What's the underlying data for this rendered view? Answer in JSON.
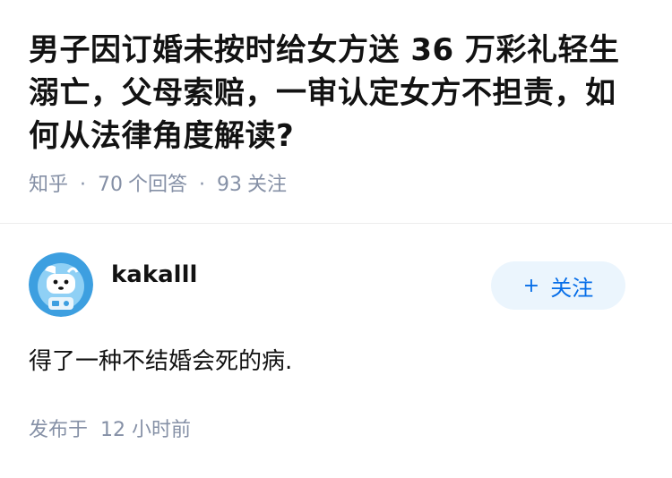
{
  "question": {
    "title": "男子因订婚未按时给女方送 36 万彩礼轻生溺亡，父母索赔，一审认定女方不担责，如何从法律角度解读?",
    "source": "知乎",
    "separator": "·",
    "answers_count": "70",
    "answers_label": "个回答",
    "followers_count": "93",
    "followers_label": "关注"
  },
  "answer": {
    "author_name": "kakalll",
    "follow_plus": "+",
    "follow_label": "关注",
    "body": "得了一种不结婚会死的病.",
    "time_prefix": "发布于",
    "time_value": "12 小时前"
  },
  "colors": {
    "title": "#121212",
    "meta": "#8590a6",
    "brand_blue": "#056de8",
    "follow_bg": "#ebf5fd",
    "avatar_bg": "#3d9fe0"
  },
  "icons": {
    "avatar": "robot-astronaut-avatar-icon"
  }
}
